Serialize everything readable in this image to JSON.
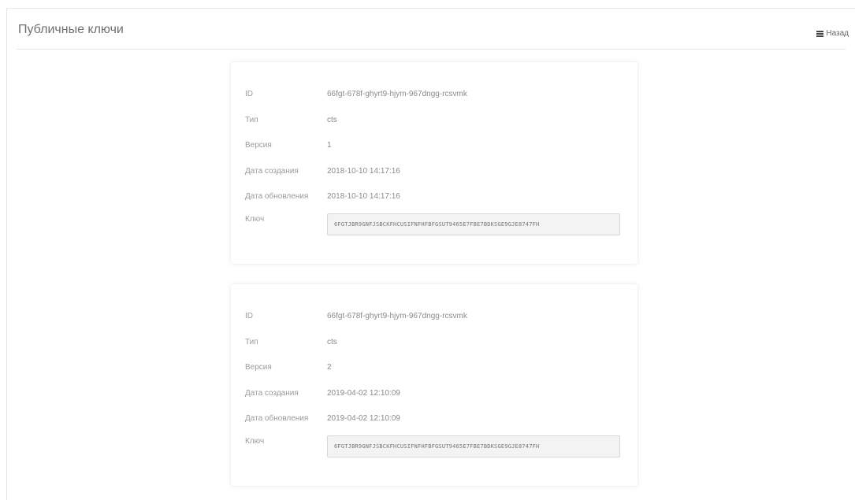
{
  "header": {
    "title": "Публичные ключи",
    "back_label": "Назад"
  },
  "labels": {
    "id": "ID",
    "type": "Тип",
    "version": "Версия",
    "created": "Дата создания",
    "updated": "Дата обновления",
    "key": "Ключ"
  },
  "keys": [
    {
      "id": "66fgt-678f-ghyrt9-hjym-967dngg-rcsvmk",
      "type": "cts",
      "version": "1",
      "created": "2018-10-10 14:17:16",
      "updated": "2018-10-10 14:17:16",
      "key": "6FGTJBR9GNFJSBCKFHCUSIFNFHFBFGSUT9465E7FBE7BDKSGE9GJE8747FH"
    },
    {
      "id": "66fgt-678f-ghyrt9-hjym-967dngg-rcsvmk",
      "type": "cts",
      "version": "2",
      "created": "2019-04-02 12:10:09",
      "updated": "2019-04-02 12:10:09",
      "key": "6FGTJBR9GNFJSBCKFHCUSIFNFHFBFGSUT9465E7FBE7BDKSGE9GJE8747FH"
    }
  ],
  "icons": {
    "back": "list-icon"
  }
}
